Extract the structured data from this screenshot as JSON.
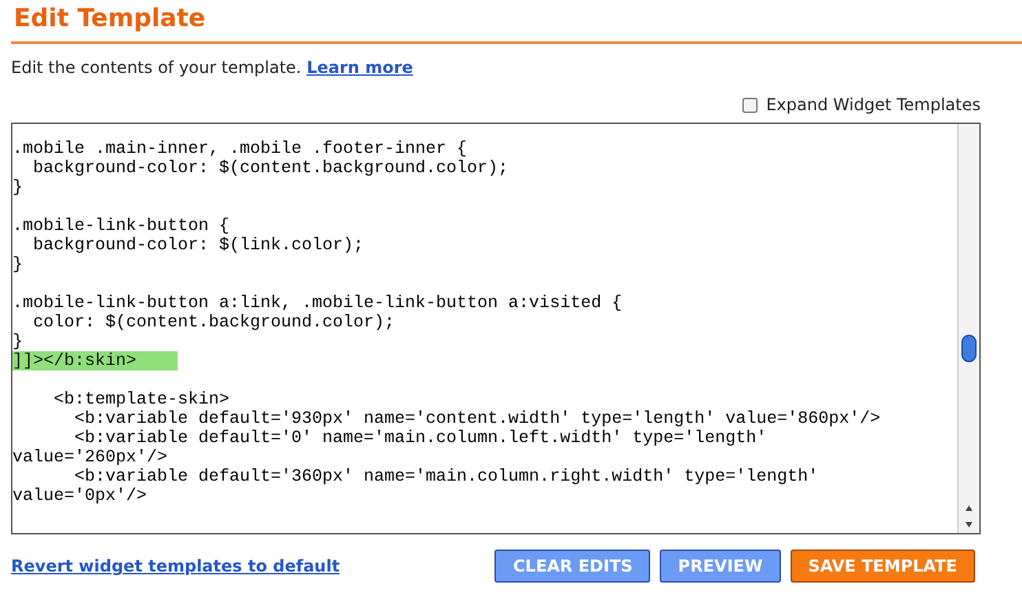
{
  "title": "Edit Template",
  "description": {
    "text": "Edit the contents of your template.",
    "link": "Learn more"
  },
  "expand_widget_templates": {
    "label": "Expand Widget Templates",
    "checked": false
  },
  "editor": {
    "blocks": [
      {
        "lines": [
          {
            "text": ".mobile .main-inner, .mobile .footer-inner {",
            "highlighted": false
          },
          {
            "text": "  background-color: $(content.background.color);",
            "highlighted": false
          },
          {
            "text": "}",
            "highlighted": false
          }
        ]
      },
      {
        "lines": [
          {
            "text": ".mobile-link-button {",
            "highlighted": false
          },
          {
            "text": "  background-color: $(link.color);",
            "highlighted": false
          },
          {
            "text": "}",
            "highlighted": false
          }
        ]
      },
      {
        "lines": [
          {
            "text": ".mobile-link-button a:link, .mobile-link-button a:visited {",
            "highlighted": false
          },
          {
            "text": "  color: $(content.background.color);",
            "highlighted": false
          },
          {
            "text": "}",
            "highlighted": false
          },
          {
            "text": "]]></b:skin>",
            "highlighted": true
          }
        ]
      },
      {
        "lines": [
          {
            "text": "    <b:template-skin>",
            "highlighted": false
          },
          {
            "text": "      <b:variable default='930px' name='content.width' type='length' value='860px'/>",
            "highlighted": false
          },
          {
            "text": "      <b:variable default='0' name='main.column.left.width' type='length'",
            "highlighted": false
          },
          {
            "text": "value='260px'/>",
            "highlighted": false
          },
          {
            "text": "      <b:variable default='360px' name='main.column.right.width' type='length'",
            "highlighted": false
          },
          {
            "text": "value='0px'/>",
            "highlighted": false
          }
        ]
      }
    ]
  },
  "revert_link": "Revert widget templates to default",
  "buttons": [
    {
      "label": "CLEAR EDITS",
      "kind": "secondary"
    },
    {
      "label": "PREVIEW",
      "kind": "secondary"
    },
    {
      "label": "SAVE TEMPLATE",
      "kind": "primary"
    }
  ]
}
